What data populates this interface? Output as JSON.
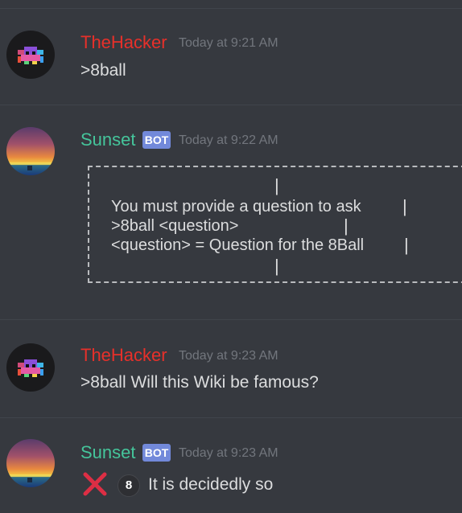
{
  "messages": [
    {
      "author": "TheHacker",
      "timestamp": "Today at 9:21 AM",
      "content": ">8ball"
    },
    {
      "author": "Sunset",
      "badge": "BOT",
      "timestamp": "Today at 9:22 AM",
      "code_lines": [
        "You must provide a question to ask",
        ">8ball <question>",
        "<question> = Question for the 8Ball"
      ],
      "pipe": "|"
    },
    {
      "author": "TheHacker",
      "timestamp": "Today at 9:23 AM",
      "content": ">8ball Will this Wiki be famous?"
    },
    {
      "author": "Sunset",
      "badge": "BOT",
      "timestamp": "Today at 9:23 AM",
      "content": "It is decidedly so",
      "x_emoji": "cross-mark-icon",
      "ball_emoji": "8",
      "ball_icon": "8ball-icon"
    }
  ],
  "colors": {
    "background": "#36393f",
    "hacker_name": "#e7302a",
    "sunset_name": "#45c59b",
    "bot_badge": "#7289da",
    "timestamp": "#72767d",
    "text": "#dcddde"
  }
}
